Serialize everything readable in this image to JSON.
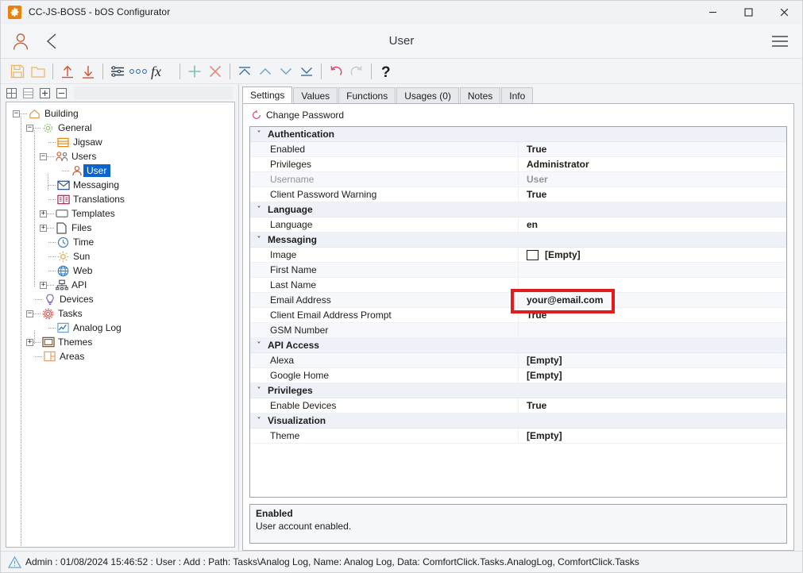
{
  "window": {
    "title": "CC-JS-BOS5 - bOS Configurator",
    "app_icon": "gear-icon",
    "controls": {
      "minimize": "minimize-icon",
      "maximize": "maximize-icon",
      "close": "close-icon"
    }
  },
  "header": {
    "user_icon": "user-icon",
    "back_icon": "back-chevron-icon",
    "title": "User",
    "menu_icon": "hamburger-menu-icon"
  },
  "toolbar": {
    "buttons": [
      {
        "name": "save-button",
        "icon": "floppy-disk-icon"
      },
      {
        "name": "open-button",
        "icon": "folder-icon"
      },
      {
        "name": "upload-button",
        "icon": "upload-arrow-icon"
      },
      {
        "name": "download-button",
        "icon": "download-arrow-icon"
      },
      {
        "name": "properties-button",
        "icon": "sliders-icon"
      },
      {
        "name": "more-options-button",
        "icon": "ellipsis-icon"
      },
      {
        "name": "function-button",
        "icon": "fx-icon"
      },
      {
        "name": "add-button",
        "icon": "plus-icon"
      },
      {
        "name": "delete-button",
        "icon": "cross-icon"
      },
      {
        "name": "move-top-button",
        "icon": "move-to-top-icon"
      },
      {
        "name": "move-up-button",
        "icon": "chevron-up-icon"
      },
      {
        "name": "move-down-button",
        "icon": "chevron-down-icon"
      },
      {
        "name": "move-bottom-button",
        "icon": "move-to-bottom-icon"
      },
      {
        "name": "undo-button",
        "icon": "undo-arrow-icon"
      },
      {
        "name": "redo-button",
        "icon": "redo-arrow-icon"
      },
      {
        "name": "help-button",
        "icon": "question-mark-icon"
      }
    ]
  },
  "tree_toolbar": {
    "buttons": [
      {
        "name": "expand-all-button",
        "icon": "expand-all-icon"
      },
      {
        "name": "collapse-all-button",
        "icon": "collapse-all-icon"
      },
      {
        "name": "expand-node-button",
        "icon": "plus-box-icon"
      },
      {
        "name": "collapse-node-button",
        "icon": "minus-box-icon"
      }
    ]
  },
  "tree": {
    "nodes": [
      {
        "label": "Building",
        "depth": 0,
        "expander": "minus",
        "icon": "house-icon",
        "selected": false
      },
      {
        "label": "General",
        "depth": 1,
        "expander": "minus",
        "icon": "gear-icon",
        "selected": false
      },
      {
        "label": "Jigsaw",
        "depth": 2,
        "expander": "none",
        "icon": "jigsaw-icon",
        "selected": false
      },
      {
        "label": "Users",
        "depth": 2,
        "expander": "minus",
        "icon": "users-icon",
        "selected": false
      },
      {
        "label": "User",
        "depth": 3,
        "expander": "none",
        "icon": "user-icon",
        "selected": true
      },
      {
        "label": "Messaging",
        "depth": 2,
        "expander": "none",
        "icon": "envelope-icon",
        "selected": false
      },
      {
        "label": "Translations",
        "depth": 2,
        "expander": "none",
        "icon": "book-icon",
        "selected": false
      },
      {
        "label": "Templates",
        "depth": 2,
        "expander": "plus",
        "icon": "template-icon",
        "selected": false
      },
      {
        "label": "Files",
        "depth": 2,
        "expander": "plus",
        "icon": "file-icon",
        "selected": false
      },
      {
        "label": "Time",
        "depth": 2,
        "expander": "none",
        "icon": "clock-icon",
        "selected": false
      },
      {
        "label": "Sun",
        "depth": 2,
        "expander": "none",
        "icon": "sun-icon",
        "selected": false
      },
      {
        "label": "Web",
        "depth": 2,
        "expander": "none",
        "icon": "globe-icon",
        "selected": false
      },
      {
        "label": "API",
        "depth": 2,
        "expander": "plus",
        "icon": "network-icon",
        "selected": false
      },
      {
        "label": "Devices",
        "depth": 1,
        "expander": "none",
        "icon": "bulb-icon",
        "selected": false
      },
      {
        "label": "Tasks",
        "depth": 1,
        "expander": "minus",
        "icon": "tasks-gear-icon",
        "selected": false
      },
      {
        "label": "Analog Log",
        "depth": 2,
        "expander": "none",
        "icon": "chart-line-icon",
        "selected": false
      },
      {
        "label": "Themes",
        "depth": 1,
        "expander": "plus",
        "icon": "themes-icon",
        "selected": false
      },
      {
        "label": "Areas",
        "depth": 1,
        "expander": "none",
        "icon": "areas-icon",
        "selected": false
      }
    ]
  },
  "tabs": [
    {
      "label": "Settings",
      "active": true
    },
    {
      "label": "Values",
      "active": false
    },
    {
      "label": "Functions",
      "active": false
    },
    {
      "label": "Usages (0)",
      "active": false
    },
    {
      "label": "Notes",
      "active": false
    },
    {
      "label": "Info",
      "active": false
    }
  ],
  "change_password": {
    "label": "Change Password",
    "icon": "refresh-circle-icon"
  },
  "property_grid": {
    "rows": [
      {
        "type": "category",
        "name": "Authentication",
        "value": "",
        "expanded": true
      },
      {
        "type": "property",
        "name": "Enabled",
        "value": "True",
        "disabled": false
      },
      {
        "type": "property",
        "name": "Privileges",
        "value": "Administrator",
        "disabled": false
      },
      {
        "type": "property",
        "name": "Username",
        "value": "User",
        "disabled": true
      },
      {
        "type": "property",
        "name": "Client Password Warning",
        "value": "True",
        "disabled": false
      },
      {
        "type": "category",
        "name": "Language",
        "value": "",
        "expanded": true
      },
      {
        "type": "property",
        "name": "Language",
        "value": "en",
        "disabled": false
      },
      {
        "type": "category",
        "name": "Messaging",
        "value": "",
        "expanded": true
      },
      {
        "type": "property",
        "name": "Image",
        "value": "[Empty]",
        "disabled": false,
        "swatch": true
      },
      {
        "type": "property",
        "name": "First Name",
        "value": "",
        "disabled": false
      },
      {
        "type": "property",
        "name": "Last Name",
        "value": "",
        "disabled": false
      },
      {
        "type": "property",
        "name": "Email Address",
        "value": "your@email.com",
        "disabled": false,
        "highlighted": true
      },
      {
        "type": "property",
        "name": "Client Email Address Prompt",
        "value": "True",
        "disabled": false
      },
      {
        "type": "property",
        "name": "GSM Number",
        "value": "",
        "disabled": false
      },
      {
        "type": "category",
        "name": "API Access",
        "value": "",
        "expanded": true
      },
      {
        "type": "property",
        "name": "Alexa",
        "value": "[Empty]",
        "disabled": false
      },
      {
        "type": "property",
        "name": "Google Home",
        "value": "[Empty]",
        "disabled": false
      },
      {
        "type": "category",
        "name": "Privileges",
        "value": "",
        "expanded": true
      },
      {
        "type": "property",
        "name": "Enable Devices",
        "value": "True",
        "disabled": false
      },
      {
        "type": "category",
        "name": "Visualization",
        "value": "",
        "expanded": true
      },
      {
        "type": "property",
        "name": "Theme",
        "value": "[Empty]",
        "disabled": false
      }
    ],
    "collapse_chevron": "˅"
  },
  "description": {
    "title": "Enabled",
    "text": "User account enabled."
  },
  "statusbar": {
    "icon": "warning-triangle-icon",
    "text": "Admin : 01/08/2024 15:46:52 : User : Add : Path: Tasks\\Analog Log, Name: Analog Log, Data: ComfortClick.Tasks.AnalogLog, ComfortClick.Tasks"
  },
  "annotation": {
    "type": "red-highlight-box",
    "target": "Email Address value",
    "color": "#e31b1b"
  }
}
